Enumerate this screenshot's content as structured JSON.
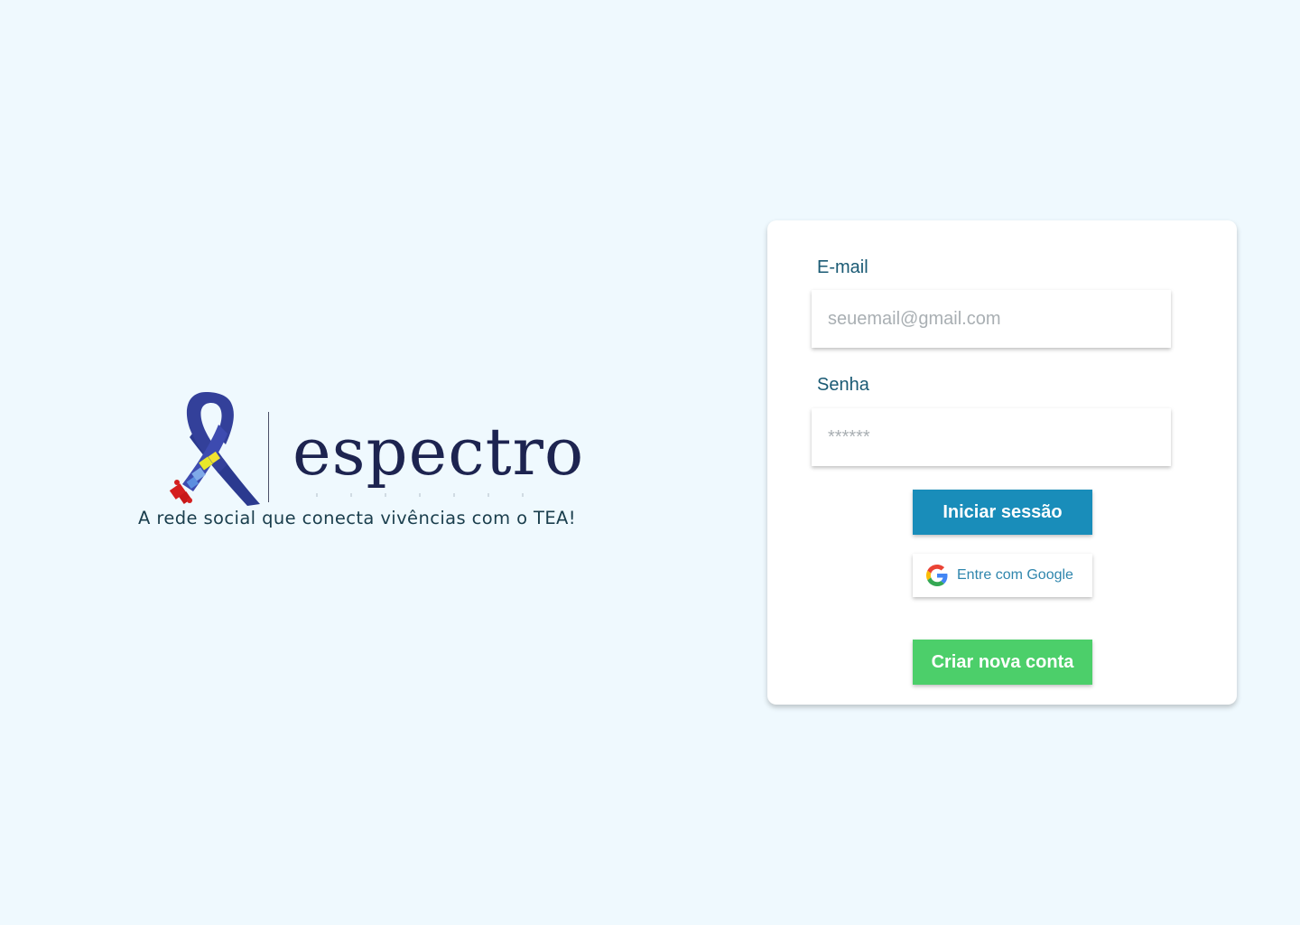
{
  "brand": {
    "name": "espectro",
    "tagline": "A rede social que conecta vivências com o TEA!",
    "logo_icon": "awareness-ribbon-puzzle-icon"
  },
  "login": {
    "email_label": "E-mail",
    "email_placeholder": "seuemail@gmail.com",
    "password_label": "Senha",
    "password_placeholder": "******",
    "login_button": "Iniciar sessão",
    "google_button": "Entre com Google",
    "google_icon": "google-g-icon",
    "create_account_button": "Criar nova conta"
  },
  "colors": {
    "background": "#eff9fe",
    "label_text": "#1a5a74",
    "login_button": "#198dba",
    "create_button": "#4ccf6a",
    "brand_text": "#1d2450"
  }
}
